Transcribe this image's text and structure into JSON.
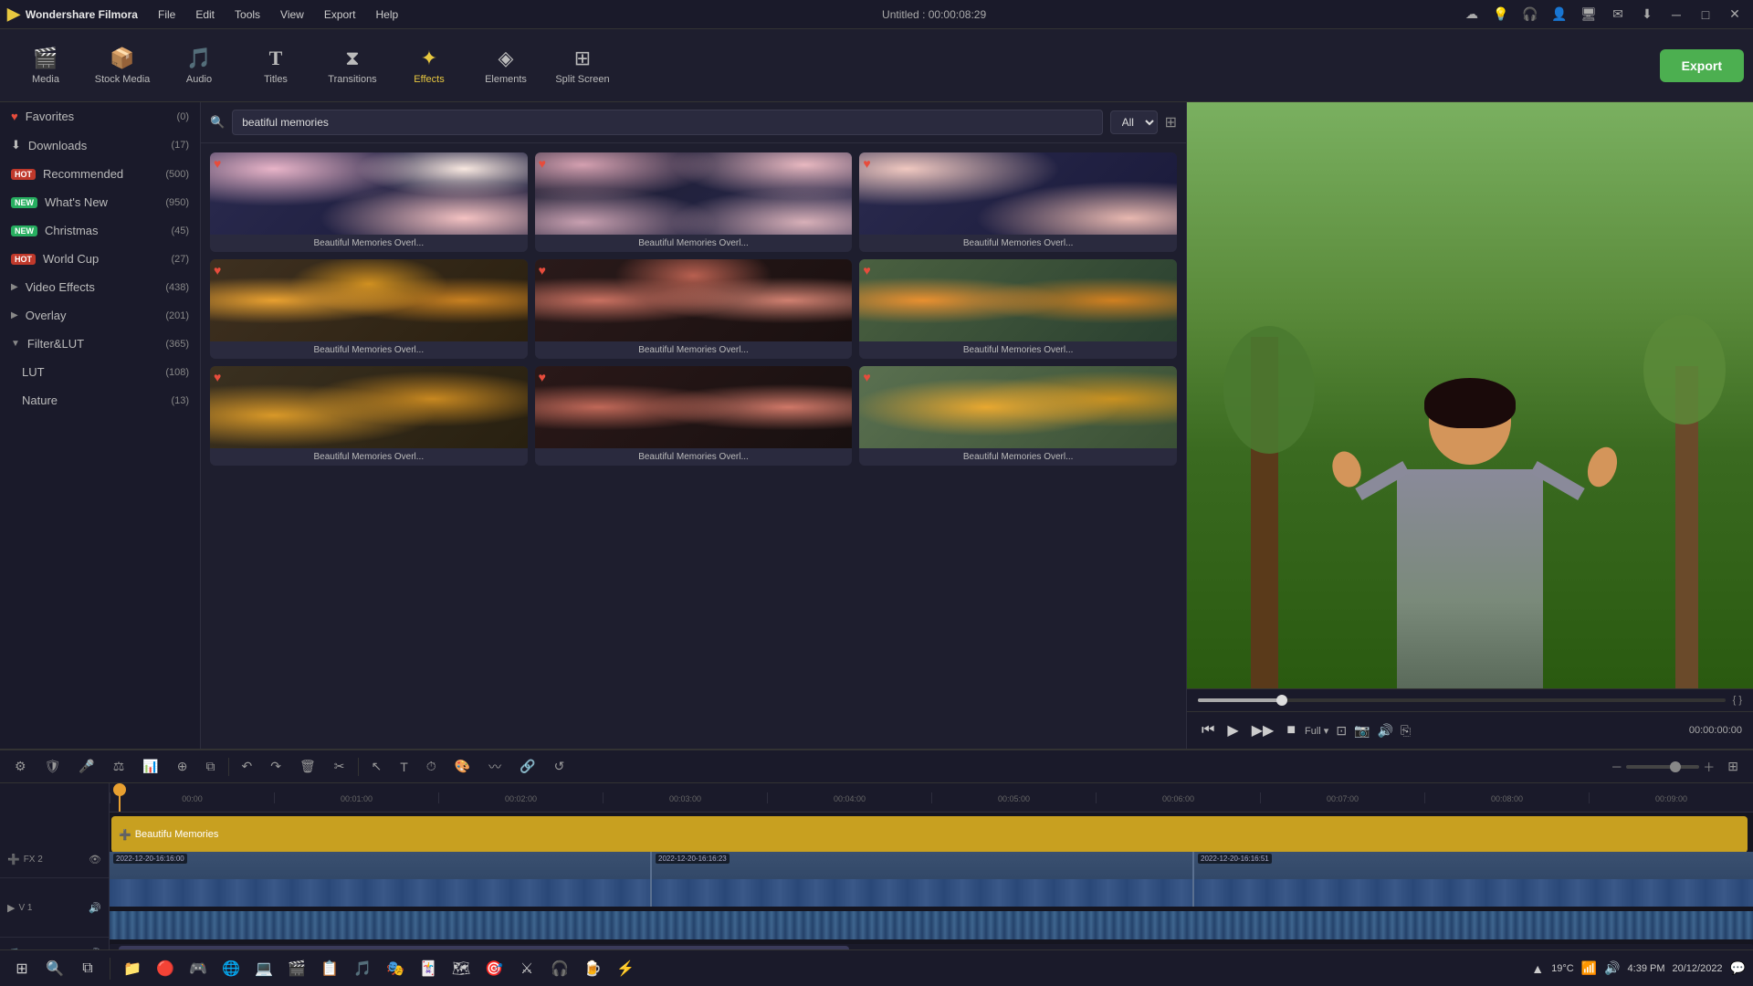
{
  "app": {
    "title": "Wondershare Filmora",
    "window_title": "Untitled : 00:00:08:29"
  },
  "menu": {
    "items": [
      "File",
      "Edit",
      "Tools",
      "View",
      "Export",
      "Help"
    ]
  },
  "toolbar": {
    "items": [
      {
        "id": "media",
        "label": "Media",
        "icon": "🎬"
      },
      {
        "id": "stock",
        "label": "Stock Media",
        "icon": "📦"
      },
      {
        "id": "audio",
        "label": "Audio",
        "icon": "🎵"
      },
      {
        "id": "titles",
        "label": "Titles",
        "icon": "T"
      },
      {
        "id": "transitions",
        "label": "Transitions",
        "icon": "✦"
      },
      {
        "id": "effects",
        "label": "Effects",
        "icon": "★",
        "active": true
      },
      {
        "id": "elements",
        "label": "Elements",
        "icon": "◈"
      },
      {
        "id": "splitscreen",
        "label": "Split Screen",
        "icon": "⊞"
      }
    ],
    "export_label": "Export"
  },
  "left_panel": {
    "items": [
      {
        "label": "Favorites",
        "count": "(0)",
        "badge": null,
        "indent": false
      },
      {
        "label": "Downloads",
        "count": "(17)",
        "badge": null,
        "indent": false
      },
      {
        "label": "Recommended",
        "count": "(500)",
        "badge": "HOT",
        "badge_type": "hot",
        "indent": false
      },
      {
        "label": "What's New",
        "count": "(950)",
        "badge": "NEW",
        "badge_type": "new",
        "indent": false
      },
      {
        "label": "Christmas",
        "count": "(45)",
        "badge": "NEW",
        "badge_type": "new",
        "indent": false
      },
      {
        "label": "World Cup",
        "count": "(27)",
        "badge": "HOT",
        "badge_type": "hot",
        "indent": false
      },
      {
        "label": "Video Effects",
        "count": "(438)",
        "badge": null,
        "indent": false,
        "arrow": "▶"
      },
      {
        "label": "Overlay",
        "count": "(201)",
        "badge": null,
        "indent": false,
        "arrow": "▶"
      },
      {
        "label": "Filter&LUT",
        "count": "(365)",
        "badge": null,
        "indent": false,
        "arrow": "▼"
      },
      {
        "label": "LUT",
        "count": "(108)",
        "badge": null,
        "indent": true
      },
      {
        "label": "Nature",
        "count": "(13)",
        "badge": null,
        "indent": true
      }
    ]
  },
  "search": {
    "placeholder": "beatiful memories",
    "value": "beatiful memories",
    "filter": "All"
  },
  "effects_grid": {
    "items": [
      {
        "label": "Beautiful Memories Overl...",
        "thumb_class": "thumb-1"
      },
      {
        "label": "Beautiful Memories Overl...",
        "thumb_class": "thumb-2"
      },
      {
        "label": "Beautiful Memories Overl...",
        "thumb_class": "thumb-3"
      },
      {
        "label": "Beautiful Memories Overl...",
        "thumb_class": "thumb-4"
      },
      {
        "label": "Beautiful Memories Overl...",
        "thumb_class": "thumb-5"
      },
      {
        "label": "Beautiful Memories Overl...",
        "thumb_class": "thumb-6"
      },
      {
        "label": "Beautiful Memories Overl...",
        "thumb_class": "thumb-7"
      },
      {
        "label": "Beautiful Memories Overl...",
        "thumb_class": "thumb-8"
      },
      {
        "label": "Beautiful Memories Overl...",
        "thumb_class": "thumb-9"
      }
    ]
  },
  "preview": {
    "time": "00:00:08:29",
    "current_time": "00:00:00:00",
    "zoom": "Full"
  },
  "timeline": {
    "ruler_marks": [
      "00:00",
      "00:01:00",
      "00:02:00",
      "00:03:00",
      "00:04:00",
      "00:05:00",
      "00:06:00",
      "00:07:00",
      "00:08:00",
      "00:09:00"
    ],
    "fx_track_label": "Beautifu Memories",
    "clips": [
      {
        "time": "2022-12-20-16:16:00"
      },
      {
        "time": "2022-12-20-16:16:23"
      },
      {
        "time": "2022-12-20-16:16:51"
      }
    ]
  },
  "taskbar": {
    "time": "4:39 PM",
    "date": "20/12/2022",
    "temp": "19°C"
  }
}
